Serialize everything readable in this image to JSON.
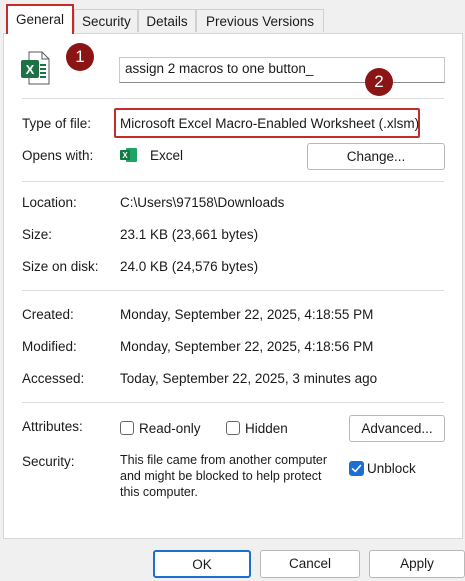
{
  "tabs": [
    {
      "label": "General"
    },
    {
      "label": "Security"
    },
    {
      "label": "Details"
    },
    {
      "label": "Previous Versions"
    }
  ],
  "file": {
    "name": "assign 2 macros to one button_",
    "icon": "excel-file-icon"
  },
  "annotations": {
    "badge1": "1",
    "badge2": "2"
  },
  "type_of_file": {
    "label": "Type of file:",
    "value": "Microsoft Excel Macro-Enabled Worksheet (.xlsm)"
  },
  "opens_with": {
    "label": "Opens with:",
    "app": "Excel",
    "change_label": "Change..."
  },
  "location": {
    "label": "Location:",
    "value": "C:\\Users\\97158\\Downloads"
  },
  "size": {
    "label": "Size:",
    "value": "23.1 KB (23,661 bytes)"
  },
  "size_on_disk": {
    "label": "Size on disk:",
    "value": "24.0 KB (24,576 bytes)"
  },
  "created": {
    "label": "Created:",
    "value": "Monday, September 22, 2025, 4:18:55 PM"
  },
  "modified": {
    "label": "Modified:",
    "value": "Monday, September 22, 2025, 4:18:56 PM"
  },
  "accessed": {
    "label": "Accessed:",
    "value": "Today, September 22, 2025, 3 minutes ago"
  },
  "attributes": {
    "label": "Attributes:",
    "readonly": "Read-only",
    "hidden": "Hidden",
    "advanced": "Advanced..."
  },
  "security": {
    "label": "Security:",
    "line1": "This file came from another computer",
    "line2": "and might be blocked to help protect",
    "line3": "this computer.",
    "unblock": "Unblock"
  },
  "footer": {
    "ok": "OK",
    "cancel": "Cancel",
    "apply": "Apply"
  },
  "colors": {
    "highlight": "#c42b2b",
    "badge": "#8b1414",
    "excel_green": "#1e7145",
    "checkbox_blue": "#1a6fd1"
  }
}
